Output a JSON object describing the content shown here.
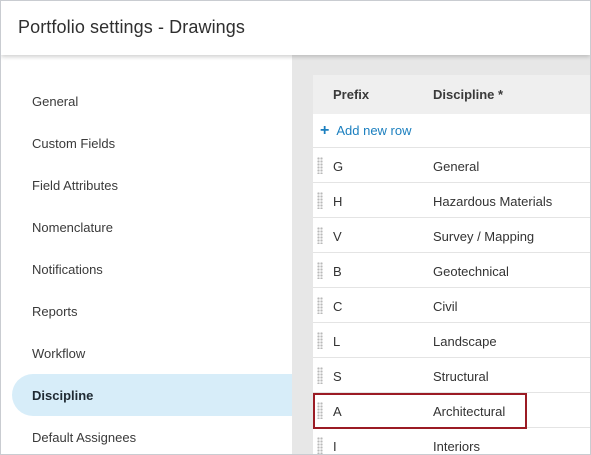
{
  "header": {
    "title": "Portfolio settings - Drawings"
  },
  "sidebar": {
    "items": [
      {
        "label": "General",
        "active": false
      },
      {
        "label": "Custom Fields",
        "active": false
      },
      {
        "label": "Field Attributes",
        "active": false
      },
      {
        "label": "Nomenclature",
        "active": false
      },
      {
        "label": "Notifications",
        "active": false
      },
      {
        "label": "Reports",
        "active": false
      },
      {
        "label": "Workflow",
        "active": false
      },
      {
        "label": "Discipline",
        "active": true
      },
      {
        "label": "Default Assignees",
        "active": false
      }
    ]
  },
  "table": {
    "columns": {
      "prefix": "Prefix",
      "discipline": "Discipline *"
    },
    "add_row_label": "Add new row",
    "rows": [
      {
        "prefix": "G",
        "discipline": "General"
      },
      {
        "prefix": "H",
        "discipline": "Hazardous Materials"
      },
      {
        "prefix": "V",
        "discipline": "Survey / Mapping"
      },
      {
        "prefix": "B",
        "discipline": "Geotechnical"
      },
      {
        "prefix": "C",
        "discipline": "Civil"
      },
      {
        "prefix": "L",
        "discipline": "Landscape"
      },
      {
        "prefix": "S",
        "discipline": "Structural"
      },
      {
        "prefix": "A",
        "discipline": "Architectural"
      },
      {
        "prefix": "I",
        "discipline": "Interiors"
      }
    ]
  },
  "colors": {
    "accent": "#1b7fbf",
    "active_nav_bg": "#d7edf9",
    "highlight_border": "#9b1b24"
  }
}
